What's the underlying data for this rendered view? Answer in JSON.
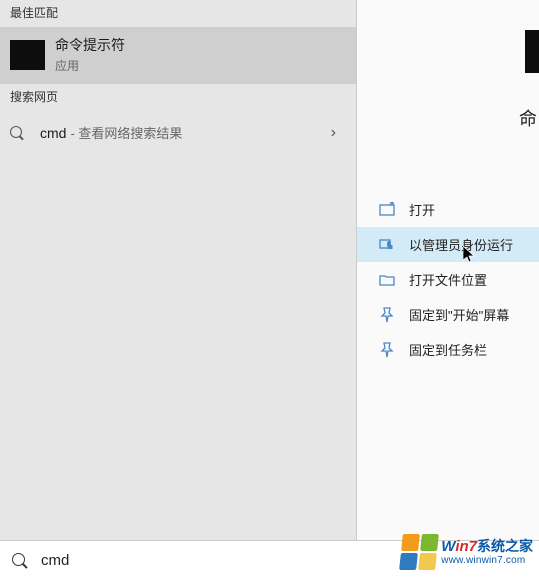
{
  "left": {
    "best_match_header": "最佳匹配",
    "best_match": {
      "title": "命令提示符",
      "subtitle": "应用"
    },
    "web_header": "搜索网页",
    "web_result": {
      "query": "cmd",
      "hint": "- 查看网络搜索结果"
    }
  },
  "right": {
    "title_partial": "命",
    "actions": [
      {
        "label": "打开",
        "icon": "open-icon"
      },
      {
        "label": "以管理员身份运行",
        "icon": "run-admin-icon"
      },
      {
        "label": "打开文件位置",
        "icon": "file-location-icon"
      },
      {
        "label": "固定到\"开始\"屏幕",
        "icon": "pin-start-icon"
      },
      {
        "label": "固定到任务栏",
        "icon": "pin-taskbar-icon"
      }
    ]
  },
  "search": {
    "value": "cmd"
  },
  "watermark": {
    "line1_w": "W",
    "line1_in7": "in7",
    "line1_zh": "系统之家",
    "line2": "www.winwin7.com"
  }
}
